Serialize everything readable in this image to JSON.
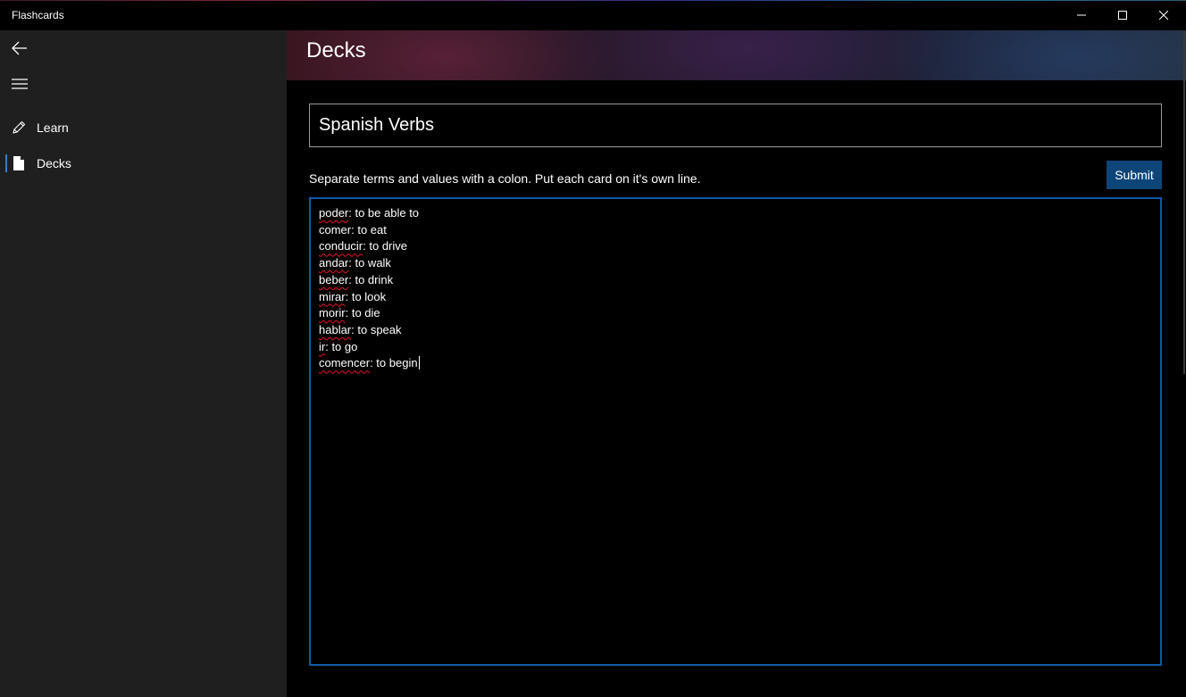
{
  "window": {
    "title": "Flashcards",
    "controls": [
      "minimize",
      "maximize",
      "close"
    ]
  },
  "sidebar": {
    "back_icon": "back-arrow-icon",
    "menu_icon": "hamburger-menu-icon",
    "items": [
      {
        "label": "Learn",
        "icon": "pencil-icon",
        "selected": false
      },
      {
        "label": "Decks",
        "icon": "document-icon",
        "selected": true
      }
    ],
    "accent": "#3a7bc8"
  },
  "header": {
    "title": "Decks"
  },
  "form": {
    "deck_name": "Spanish Verbs",
    "instructions": "Separate terms and values with a colon. Put each card on it's own line.",
    "submit_label": "Submit",
    "cards": [
      {
        "term": "poder",
        "value": ": to be able to"
      },
      {
        "term": "comer",
        "value": ": to eat"
      },
      {
        "term": "conducir",
        "value": ": to drive"
      },
      {
        "term": "andar",
        "value": ": to walk"
      },
      {
        "term": "beber",
        "value": ": to drink"
      },
      {
        "term": "mirar",
        "value": ": to look"
      },
      {
        "term": "morir",
        "value": ": to die"
      },
      {
        "term": "hablar",
        "value": ": to speak"
      },
      {
        "term": "ir",
        "value": ": to go"
      },
      {
        "term": "comencer",
        "value": ": to begin"
      }
    ]
  },
  "colors": {
    "submit_bg": "#0e4578",
    "textarea_focus_border": "#0e5aa7",
    "spellcheck_underline": "#e81123"
  }
}
